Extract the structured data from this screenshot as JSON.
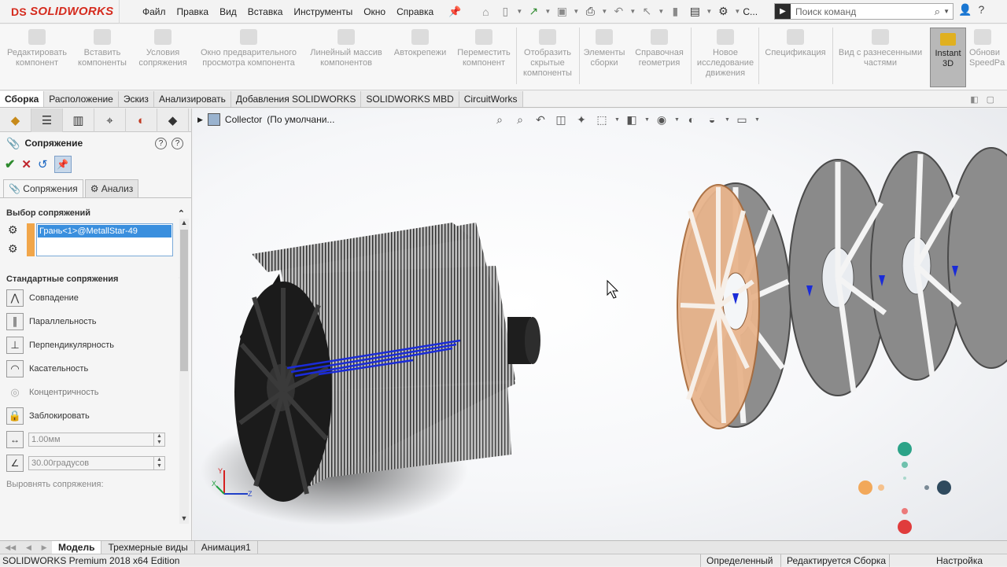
{
  "app": {
    "logo_text": "SOLIDWORKS",
    "logo_mark": "DS"
  },
  "menu": [
    "Файл",
    "Правка",
    "Вид",
    "Вставка",
    "Инструменты",
    "Окно",
    "Справка"
  ],
  "toolbar_extra_label": "С...",
  "search": {
    "placeholder": "Поиск команд"
  },
  "ribbon": [
    {
      "label": "Редактировать компонент",
      "icon": "edit-component-icon"
    },
    {
      "label": "Вставить компоненты",
      "icon": "insert-components-icon"
    },
    {
      "label": "Условия сопряжения",
      "icon": "mate-icon"
    },
    {
      "label": "Окно предварительного просмотра компонента",
      "icon": "preview-window-icon"
    },
    {
      "label": "Линейный массив компонентов",
      "icon": "linear-pattern-icon"
    },
    {
      "label": "Автокрепежи",
      "icon": "smart-fasteners-icon"
    },
    {
      "label": "Переместить компонент",
      "icon": "move-component-icon"
    },
    {
      "label": "Отобразить скрытые компоненты",
      "icon": "show-hidden-icon"
    },
    {
      "label": "Элементы сборки",
      "icon": "assembly-features-icon"
    },
    {
      "label": "Справочная геометрия",
      "icon": "reference-geometry-icon"
    },
    {
      "label": "Новое исследование движения",
      "icon": "motion-study-icon"
    },
    {
      "label": "Спецификация",
      "icon": "bom-icon"
    },
    {
      "label": "Вид с разнесенными частями",
      "icon": "exploded-view-icon"
    },
    {
      "label": "Instant 3D",
      "icon": "instant3d-icon"
    },
    {
      "label": "Обнови SpeedPa",
      "icon": "speedpak-icon"
    }
  ],
  "tabs": [
    "Сборка",
    "Расположение",
    "Эскиз",
    "Анализировать",
    "Добавления SOLIDWORKS",
    "SOLIDWORKS MBD",
    "CircuitWorks"
  ],
  "property_manager": {
    "title": "Сопряжение",
    "subtabs": [
      "Сопряжения",
      "Анализ"
    ],
    "selection_group": "Выбор сопряжений",
    "selection_item": "Грань<1>@MetallStar-49",
    "standard_group": "Стандартные сопряжения",
    "mates": [
      {
        "label": "Совпадение",
        "icon": "coincident-icon"
      },
      {
        "label": "Параллельность",
        "icon": "parallel-icon"
      },
      {
        "label": "Перпендикулярность",
        "icon": "perpendicular-icon"
      },
      {
        "label": "Касательность",
        "icon": "tangent-icon"
      },
      {
        "label": "Концентричность",
        "icon": "concentric-icon"
      },
      {
        "label": "Заблокировать",
        "icon": "lock-icon"
      }
    ],
    "distance_value": "1.00мм",
    "angle_value": "30.00градусов",
    "align_label": "Выровнять сопряжения:"
  },
  "viewport": {
    "tree_root": "Collector",
    "tree_config": "(По умолчани..."
  },
  "bottom_tabs": [
    "Модель",
    "Трехмерные виды",
    "Анимация1"
  ],
  "status": {
    "product": "SOLIDWORKS Premium 2018 x64 Edition",
    "defined": "Определенный",
    "editing": "Редактируется Сборка",
    "settings": "Настройка"
  },
  "colors": {
    "accent": "#d52b1e",
    "selection": "#3a8fde",
    "highlight_part": "#e8b48c"
  }
}
